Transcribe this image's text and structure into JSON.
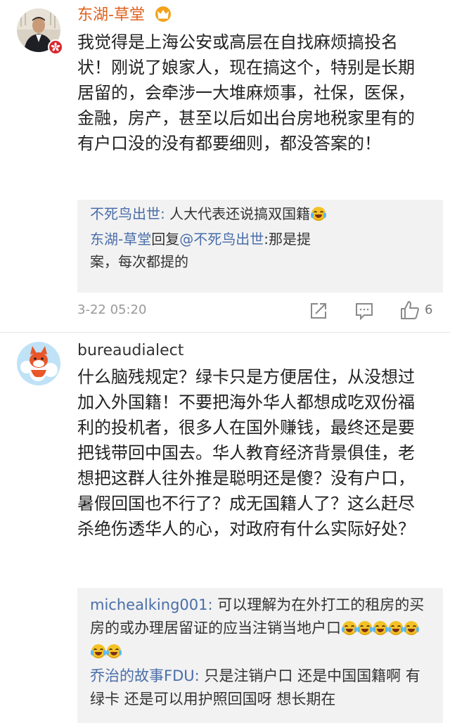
{
  "comments": [
    {
      "username": "东湖-草堂",
      "username_color": "#e0621f",
      "badge": "crown-badge-icon",
      "body": "我觉得是上海公安或高层在自找麻烦搞投名状！刚说了娘家人，现在搞这个，特别是长期居留的，会牵涉一大堆麻烦事，社保，医保，金融，房产，甚至以后如出台房地税家里有的有户口没的没有都要细则，都没答案的！",
      "replies": [
        {
          "user": "不死鸟出世",
          "sep": ": ",
          "text": "人大代表还说搞双国籍"
        },
        {
          "user": "东湖-草堂",
          "mid": "回复",
          "user2": "@不死鸟出世",
          "sep": ":",
          "text": "那是提案，每次都提的"
        }
      ],
      "timestamp": "3-22 05:20",
      "like_count": "6"
    },
    {
      "username": "bureaudialect",
      "username_color": "#333333",
      "body": "什么脑残规定？绿卡只是方便居住，从没想过加入外国籍！不要把海外华人都想成吃双份福利的投机者，很多人在国外赚钱，最终还是要把钱带回中国去。华人教育经济背景俱佳，老想把这群人往外推是聪明还是傻？没有户口，暑假回国也不行了？成无国籍人了？这么赶尽杀绝伤透华人的心，对政府有什么实际好处？",
      "replies": [
        {
          "user": "michealking001",
          "sep": ": ",
          "text": "可以理解为在外打工的租房的买房的或办理居留证的应当注销当地户口"
        },
        {
          "user": "乔治的故事FDU",
          "sep": ": ",
          "text": "只是注销户口 还是中国国籍啊 有绿卡 还是可以用护照回国呀 想长期在"
        }
      ]
    }
  ],
  "colors": {
    "link_blue": "#4a6ea9",
    "reply_bg": "#f2f2f2",
    "meta_gray": "#999999"
  }
}
